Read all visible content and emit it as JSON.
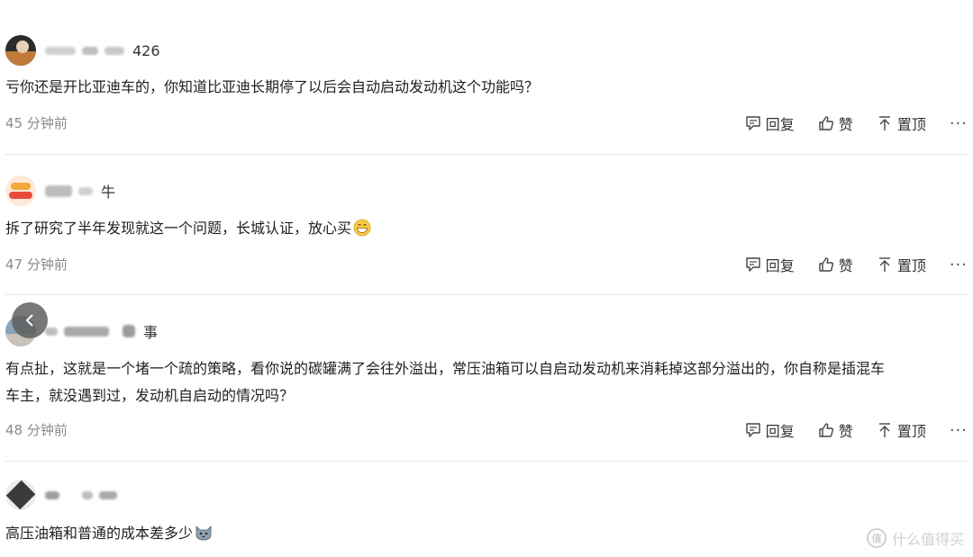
{
  "comments": [
    {
      "username_visible": "426",
      "text": "亏你还是开比亚迪车的，你知道比亚迪长期停了以后会自动启动发动机这个功能吗？",
      "time": "45 分钟前"
    },
    {
      "username_visible": "牛",
      "text": "拆了研究了半年发现就这一个问题，长城认证，放心买",
      "emoji": "grinning-face-emoji",
      "time": "47 分钟前"
    },
    {
      "username_visible": "事",
      "text_line1": "有点扯，这就是一个堵一个疏的策略，看你说的碳罐满了会往外溢出，常压油箱可以自启动发动机来消耗掉这部分溢出的，你自称是插混车",
      "text_line2": "车主，就没遇到过，发动机自启动的情况吗？",
      "time": "48 分钟前"
    },
    {
      "username_visible": "",
      "text": "高压油箱和普通的成本差多少",
      "emoji": "cat-face-emoji"
    }
  ],
  "actions": {
    "reply": "回复",
    "like": "赞",
    "pin": "置顶",
    "more": "···"
  },
  "icons": {
    "reply": "comment-icon",
    "like": "thumbs-up-icon",
    "pin": "pin-top-icon",
    "back": "chevron-left-icon"
  },
  "watermark": {
    "mark": "值",
    "text": "什么值得买"
  },
  "colors": {
    "text": "#1f1f1f",
    "meta": "#8a8a8a",
    "divider": "#e6e6e6",
    "watermark": "#d0d0d0"
  }
}
